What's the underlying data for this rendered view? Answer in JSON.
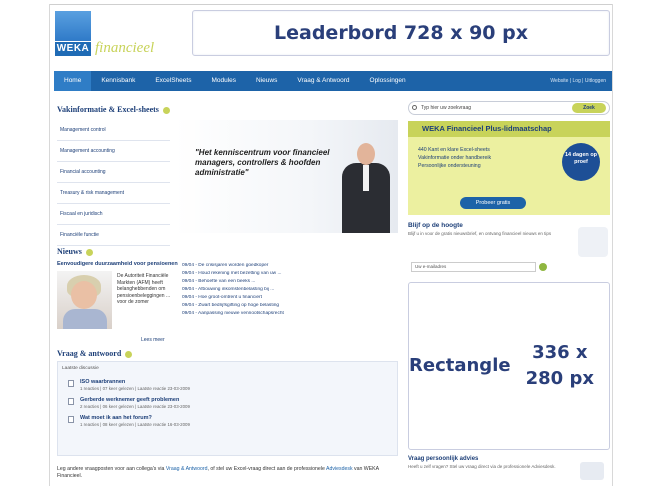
{
  "header": {
    "logo_text": "WEKA",
    "logo_sub": "financieel",
    "leaderboard": "Leaderbord 728 x 90 px"
  },
  "nav": {
    "tabs": [
      "Home",
      "Kennisbank",
      "ExcelSheets",
      "Modules",
      "Nieuws",
      "Vraag & Antwoord",
      "Oplossingen"
    ],
    "right": "Website | Log | Uitloggen"
  },
  "main": {
    "section_title": "Vakinformatie & Excel-sheets",
    "menu": [
      "Management control",
      "Management accounting",
      "Financial accounting",
      "Treasury & risk management",
      "Fiscaal en juridisch",
      "Financiële functie"
    ],
    "hero_quote": "\"Het kenniscentrum voor financieel managers, controllers & hoofden administratie\"",
    "news_title": "Nieuws",
    "news_headline": "Eenvoudigere duurzaamheid voor pensioenen",
    "news_text": "De Autoriteit Financiële Markten (AFM) heeft belanghebbenden om pensioenbeleggingen ... voor de zomer",
    "news_more": "Lees meer",
    "news_list": [
      "09/04 - De crisisjaren worden goedkoper",
      "09/04 - Houd rekening met bezetting van uw ...",
      "09/04 - Behoefte van een beeks ...",
      "09/04 - Afbouwing inkomstenbelasting bij ...",
      "09/04 - Hoe groot-omtrent u financiert",
      "09/04 - Zwart bedrijfsgifting op hoge belasting",
      "09/04 - Aanpassing nieuwe vennootschapsrecht"
    ],
    "qa_title": "Vraag & antwoord",
    "qa_head": "Laatste discussie",
    "questions": [
      {
        "title": "ISO waarbrannen",
        "meta": "1 reacties | 07 keer gelezen | Laatste reactie 23-03-2009"
      },
      {
        "title": "Gerberde werknemer geeft problemen",
        "meta": "2 reacties | 06 keer gelezen | Laatste reactie 23-03-2009"
      },
      {
        "title": "Wat moet ik aan het forum?",
        "meta": "1 reacties | 08 keer gelezen | Laatste reactie 16-03-2009"
      }
    ],
    "footer_text_a": "Leg andere vraagposten voor aan collega's via",
    "footer_link_a": "Vraag & Antwoord",
    "footer_text_b": ", of stel uw Excel-vraag direct aan de professionele",
    "footer_link_b": "Adviesdesk",
    "footer_text_c": "van WEKA Financieel."
  },
  "sidebar": {
    "search_placeholder": "Typ hier uw zoekvraag",
    "search_button": "Zoek",
    "plus_title": "WEKA Financieel Plus-lidmaatschap",
    "plus_items": [
      "440 Kant en klare Excel-sheets",
      "Vakinformatie onder handbereik",
      "Persoonlijke ondersteuning"
    ],
    "plus_badge": "14 dagen op proef",
    "plus_button": "Probeer gratis",
    "stay_title": "Blijf op de hoogte",
    "stay_desc": "Blijf u in voor de gratis nieuwsbrief, en ontvang financieel nieuws en tips",
    "stay_email": "Uw e-mailadres",
    "rectangle": "Rectangle 336 x 280 px",
    "advice_title": "Vraag persoonlijk advies",
    "advice_desc": "Heeft u zelf vragen? Stel uw vraag direct via de professionele Adviesdesk."
  }
}
